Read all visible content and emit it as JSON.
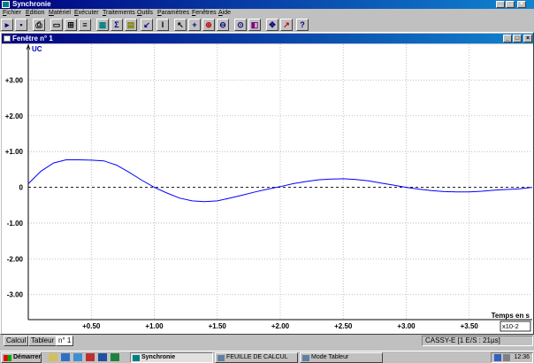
{
  "app": {
    "title": "Synchronie"
  },
  "menu": {
    "items": [
      "Fichier",
      "Edition",
      "Matériel",
      "Exécuter",
      "Traitements",
      "Outils",
      "Paramètres",
      "Fenêtres",
      "Aide"
    ]
  },
  "toolbar": {
    "icons": [
      "open-icon",
      "save-icon",
      "print-icon",
      "window-icon",
      "tile-icon",
      "list-icon",
      "calculator-icon",
      "sigma-icon",
      "table-icon",
      "pen-icon",
      "text-cursor-icon",
      "pointer-icon",
      "crosshair-icon",
      "zoom-in-icon",
      "zoom-out-icon",
      "zoom-fit-icon",
      "color-icon",
      "move-icon",
      "chart-icon",
      "help-icon"
    ]
  },
  "window": {
    "title": "Fenêtre n° 1"
  },
  "chart_data": {
    "type": "line",
    "series": [
      {
        "name": "UC",
        "color": "#0000ff",
        "x": [
          0.0,
          0.1,
          0.2,
          0.3,
          0.4,
          0.5,
          0.6,
          0.7,
          0.8,
          0.9,
          1.0,
          1.1,
          1.2,
          1.3,
          1.4,
          1.5,
          1.6,
          1.7,
          1.8,
          1.9,
          2.0,
          2.1,
          2.2,
          2.3,
          2.4,
          2.5,
          2.6,
          2.7,
          2.8,
          2.9,
          3.0,
          3.1,
          3.2,
          3.3,
          3.4,
          3.5,
          3.6,
          3.7,
          3.8,
          3.9,
          4.0
        ],
        "y": [
          0.1,
          0.45,
          0.68,
          0.77,
          0.77,
          0.76,
          0.74,
          0.62,
          0.42,
          0.2,
          0.0,
          -0.16,
          -0.3,
          -0.38,
          -0.4,
          -0.38,
          -0.3,
          -0.22,
          -0.13,
          -0.05,
          0.02,
          0.1,
          0.16,
          0.21,
          0.23,
          0.24,
          0.22,
          0.18,
          0.12,
          0.06,
          0.0,
          -0.05,
          -0.09,
          -0.12,
          -0.13,
          -0.13,
          -0.11,
          -0.08,
          -0.06,
          -0.04,
          0.0
        ]
      }
    ],
    "y_label": "UC",
    "x_label": "Temps en s",
    "x_multiplier": "x10-2",
    "y_ticks": [
      "+3.00",
      "+2.00",
      "+1.00",
      "0",
      "-1.00",
      "-2.00",
      "-3.00"
    ],
    "y_tick_values": [
      3,
      2,
      1,
      0,
      -1,
      -2,
      -3
    ],
    "x_ticks": [
      "+0.50",
      "+1.00",
      "+1.50",
      "+2.00",
      "+2.50",
      "+3.00",
      "+3.50"
    ],
    "x_tick_values": [
      0.5,
      1.0,
      1.5,
      2.0,
      2.5,
      3.0,
      3.5
    ],
    "xlim": [
      0,
      4.0
    ],
    "ylim": [
      -3.7,
      4.0
    ],
    "grid": true,
    "zero_line": "dashed"
  },
  "tabs": [
    {
      "label": "Calcul"
    },
    {
      "label": "Tableur"
    },
    {
      "label": "n° 1"
    }
  ],
  "status": {
    "text": "CASSY-E [1 E/S : 21µs]"
  },
  "taskbar": {
    "start_label": "Démarrer",
    "tasks": [
      {
        "label": "Synchronie"
      },
      {
        "label": "FEUILLE DE CALCUL"
      },
      {
        "label": "Mode Tableur"
      }
    ],
    "clock": "12:36"
  }
}
